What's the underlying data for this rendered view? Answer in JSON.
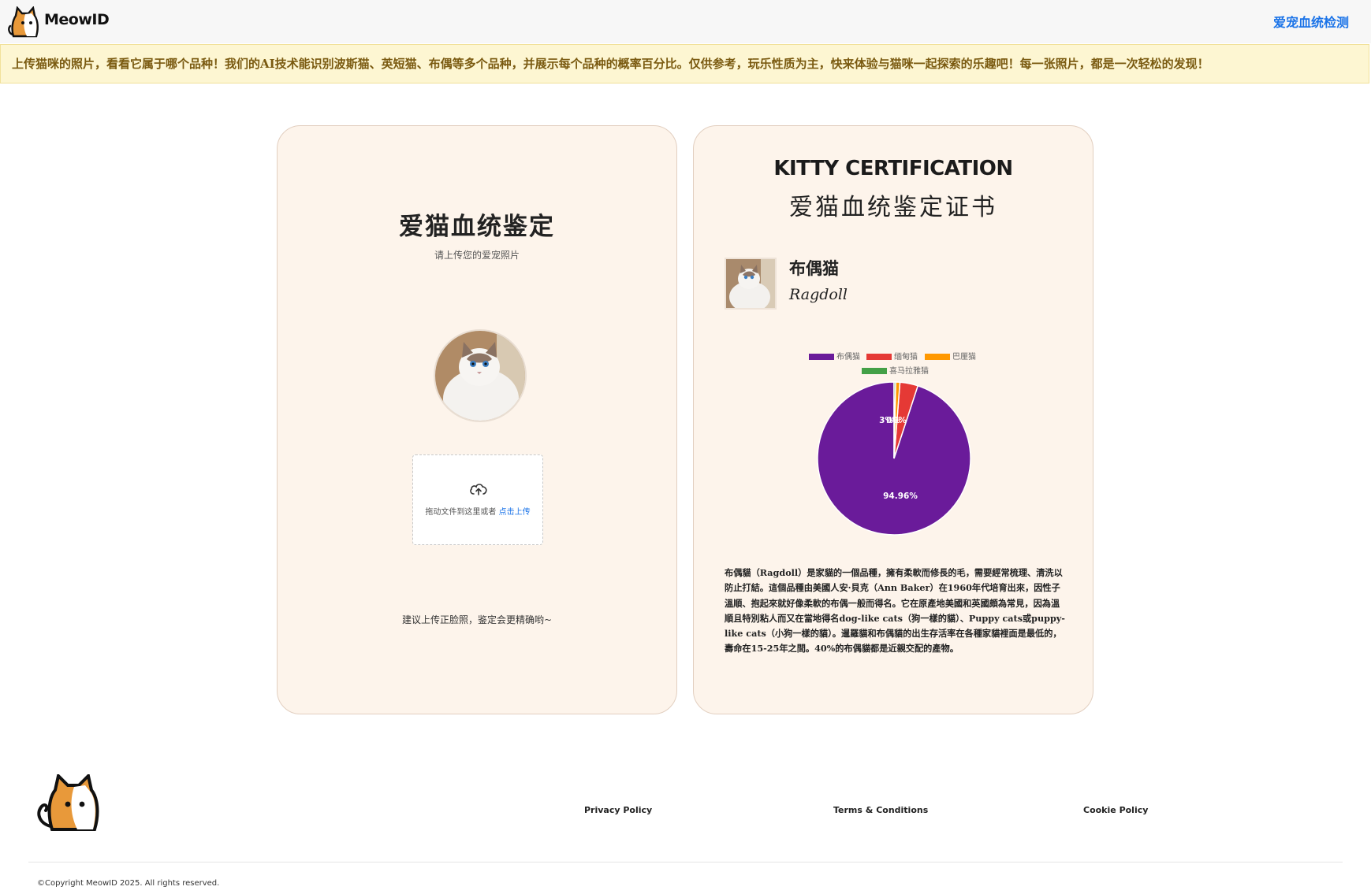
{
  "header": {
    "brand": "MeowID",
    "nav_link": "爱宠血统检测"
  },
  "notice": "上传猫咪的照片，看看它属于哪个品种！我们的AI技术能识别波斯猫、英短猫、布偶等多个品种，并展示每个品种的概率百分比。仅供参考，玩乐性质为主，快来体验与猫咪一起探索的乐趣吧！每一张照片，都是一次轻松的发现！",
  "upload": {
    "title": "爱猫血统鉴定",
    "subtitle": "请上传您的爱宠照片",
    "dropzone_text": "拖动文件到这里或者 ",
    "dropzone_link": "点击上传",
    "tip": "建议上传正脸照，鉴定会更精确哟~"
  },
  "certificate": {
    "title_en": "KITTY CERTIFICATION",
    "title_zh": "爱猫血统鉴定证书",
    "breed_zh": "布偶猫",
    "breed_en": "Ragdoll",
    "description": "布偶貓（Ragdoll）是家貓的一個品種，擁有柔軟而修長的毛，需要經常梳理、清洗以防止打結。這個品種由美國人安·貝克（Ann Baker）在1960年代培育出來，因性子溫順、抱起來就好像柔軟的布偶一般而得名。它在原產地美國和英國頗為常見，因為溫順且特別粘人而又在當地得名dog-like cats（狗一樣的貓）、Puppy cats或puppy-like cats（小狗一樣的貓）。暹羅貓和布偶貓的出生存活率在各種家貓裡面是最低的，壽命在15-25年之間。40%的布偶貓都是近親交配的產物。"
  },
  "chart_data": {
    "type": "pie",
    "categories": [
      "布偶猫",
      "缅甸猫",
      "巴厘猫",
      "喜马拉雅猫"
    ],
    "values": [
      94.96,
      3.8,
      0.9,
      0.34
    ],
    "colors": [
      "#6a1b9a",
      "#e53935",
      "#ff9800",
      "#43a047"
    ],
    "visible_labels": [
      "94.96%",
      "3%",
      "0%",
      "0%"
    ],
    "legend": "top"
  },
  "footer": {
    "links": [
      "Privacy Policy",
      "Terms & Conditions",
      "Cookie Policy"
    ],
    "copyright": "©Copyright MeowID 2025. All rights reserved."
  },
  "colors": {
    "accent": "#1a73e8",
    "card_bg": "#fdf4eb",
    "notice_bg": "#fdf6d2",
    "cat_orange": "#e8993a"
  }
}
